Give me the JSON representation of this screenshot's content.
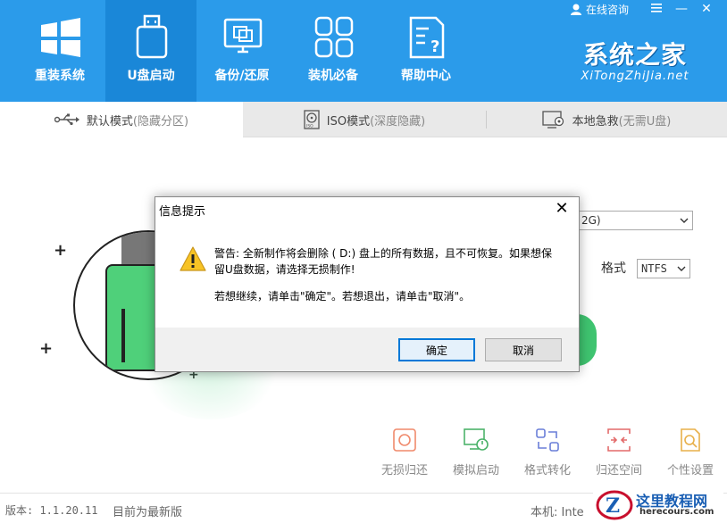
{
  "colors": {
    "header": "#2b9bea",
    "active_nav": "#1a87d8",
    "accent_green": "#3fc470"
  },
  "nav": [
    {
      "label": "重装系统",
      "icon": "windows-logo-icon"
    },
    {
      "label": "U盘启动",
      "icon": "usb-drive-icon"
    },
    {
      "label": "备份/还原",
      "icon": "backup-restore-icon"
    },
    {
      "label": "装机必备",
      "icon": "apps-grid-icon"
    },
    {
      "label": "帮助中心",
      "icon": "help-document-icon"
    }
  ],
  "topbar": {
    "online_consult": "在线咨询",
    "menu_icon": "hamburger-icon",
    "min": "—",
    "close": "✕"
  },
  "brand": {
    "main": "系统之家",
    "sub": "XiTongZhiJia.net"
  },
  "tabs": [
    {
      "label": "默认模式",
      "sub": "(隐藏分区)"
    },
    {
      "label": "ISO模式",
      "sub": "(深度隐藏)"
    },
    {
      "label": "本地急救",
      "sub": "(无需U盘)"
    }
  ],
  "device_select": {
    "value": "2G)"
  },
  "format": {
    "label": "格式",
    "value": "NTFS"
  },
  "tools": [
    {
      "label": "无损归还",
      "icon": "restore-icon"
    },
    {
      "label": "模拟启动",
      "icon": "simulate-boot-icon"
    },
    {
      "label": "格式转化",
      "icon": "format-convert-icon"
    },
    {
      "label": "归还空间",
      "icon": "return-space-icon"
    },
    {
      "label": "个性设置",
      "icon": "personalize-icon"
    }
  ],
  "footer": {
    "version": "版本: 1.1.20.11",
    "latest": "目前为最新版",
    "local": "本机: Inte"
  },
  "watermark": {
    "name": "这里教程网",
    "url": "herecours.com"
  },
  "dialog": {
    "title": "信息提示",
    "close": "✕",
    "message": "警告: 全新制作将会删除 ( D:) 盘上的所有数据，且不可恢复。如果想保留U盘数据，请选择无损制作!",
    "message2": "若想继续，请单击\"确定\"。若想退出，请单击\"取消\"。",
    "ok": "确定",
    "cancel": "取消"
  }
}
